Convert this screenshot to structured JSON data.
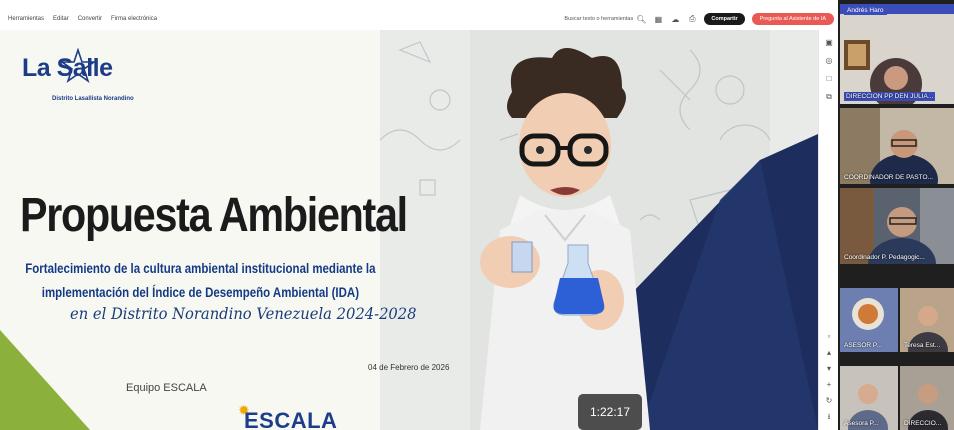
{
  "toolbar": {
    "menu": [
      "Herramientas",
      "Editar",
      "Convertir",
      "Firma electrónica"
    ],
    "search_label": "Buscar texto o herramientas",
    "share_label": "Compartir",
    "ai_label": "Pregunta al Asistente de IA"
  },
  "slide": {
    "logo_text": "La Salle",
    "logo_sub": "Distrito Lasallista Norandino",
    "title": "Propuesta Ambiental",
    "subtitle": "Fortalecimiento de la cultura ambiental institucional mediante la implementación del Índice de Desempeño Ambiental (IDA)",
    "script_line": "en el Distrito Norandino Venezuela 2024-2028",
    "date": "04 de Febrero de 2026",
    "team": "Equipo ESCALA",
    "escala": "ESCALA"
  },
  "timer": "1:22:17",
  "participants": [
    {
      "name": "Andrés Haro"
    },
    {
      "name": "DIRECCION PP DEN JULIA..."
    },
    {
      "name": "COORDINADOR DE PASTO..."
    },
    {
      "name": "Coordinador P. Pedagogic..."
    },
    {
      "name": "ASESOR P..."
    },
    {
      "name": "Teresa Est..."
    },
    {
      "name": "Asesora P..."
    },
    {
      "name": "DIRECCIO..."
    }
  ],
  "colors": {
    "brand_blue": "#1c3c87",
    "navy": "#1d2e5e",
    "green": "#8bb03c",
    "ai_button": "#e95a55",
    "highlight": "#3b4db8"
  }
}
